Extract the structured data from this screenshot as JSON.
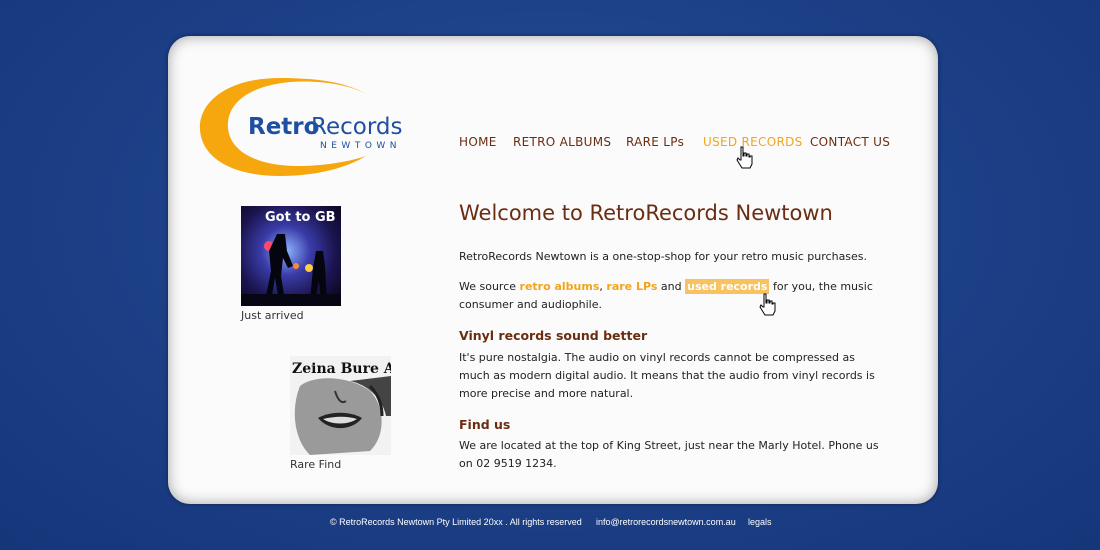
{
  "logo": {
    "word1": "Retro",
    "word2": "Records",
    "sub": "NEWTOWN"
  },
  "nav": [
    {
      "label": "HOME"
    },
    {
      "label": "RETRO ALBUMS"
    },
    {
      "label": "RARE LPs"
    },
    {
      "label": "USED RECORDS",
      "active": true
    },
    {
      "label": "CONTACT US"
    }
  ],
  "sidebar": {
    "item1": {
      "image_text": "Got to GB",
      "caption": "Just arrived"
    },
    "item2": {
      "image_text": "Zeina Bure AVE",
      "caption": "Rare Find"
    }
  },
  "main": {
    "title": "Welcome to RetroRecords Newtown",
    "intro": "RetroRecords Newtown is a one-stop-shop for your retro music purchases.",
    "source": {
      "prefix": "We source ",
      "link1": "retro albums",
      "sep": ", ",
      "link2": "rare LPs",
      "and": " and ",
      "link3": "used records",
      "suffix": " for you, the music consumer and audiophile."
    },
    "section1": {
      "heading": "Vinyl records sound better",
      "body": "It's pure nostalgia. The audio on vinyl records cannot be compressed as much as modern digital audio. It means that the audio from vinyl records is more precise and more natural."
    },
    "section2": {
      "heading": "Find us",
      "body": "We are located at the top of King Street, just near the Marly Hotel. Phone us on 02 9519 1234."
    }
  },
  "footer": {
    "copyright": "© RetroRecords Newtown Pty Limited 20xx . All rights reserved",
    "email": "info@retrorecordsnewtown.com.au",
    "legals": "legals"
  },
  "colors": {
    "brand_blue": "#1f4fa0",
    "accent_orange": "#f2a51c",
    "heading_brown": "#6b2d12"
  }
}
